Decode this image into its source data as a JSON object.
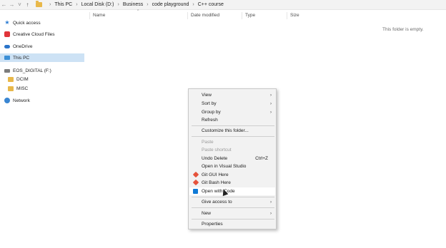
{
  "address_bar": {
    "back": "←",
    "forward": "→",
    "recent": "˅",
    "up": "↑",
    "breadcrumbs": [
      "This PC",
      "Local Disk (D:)",
      "Business",
      "code playground",
      "C++ course"
    ],
    "separator": "›"
  },
  "sidebar": {
    "items": [
      {
        "label": "Quick access",
        "icon": "star-icon"
      },
      {
        "label": "Creative Cloud Files",
        "icon": "creative-cloud-icon"
      },
      {
        "label": "OneDrive",
        "icon": "onedrive-icon"
      },
      {
        "label": "This PC",
        "icon": "this-pc-icon"
      },
      {
        "label": "EOS_DIGITAL (F:)",
        "icon": "drive-icon"
      },
      {
        "label": "DCIM",
        "icon": "folder-icon"
      },
      {
        "label": "MISC",
        "icon": "folder-icon"
      },
      {
        "label": "Network",
        "icon": "network-icon"
      }
    ]
  },
  "columns": {
    "name": "Name",
    "date_modified": "Date modified",
    "type": "Type",
    "size": "Size",
    "sort_caret": "^"
  },
  "empty_message": "This folder is empty.",
  "context_menu": {
    "items": [
      {
        "label": "View",
        "submenu": true
      },
      {
        "label": "Sort by",
        "submenu": true
      },
      {
        "label": "Group by",
        "submenu": true
      },
      {
        "label": "Refresh"
      },
      {
        "label": "Customize this folder..."
      },
      {
        "label": "Paste",
        "disabled": true
      },
      {
        "label": "Paste shortcut",
        "disabled": true
      },
      {
        "label": "Undo Delete",
        "shortcut": "Ctrl+Z"
      },
      {
        "label": "Open in Visual Studio"
      },
      {
        "label": "Git GUI Here",
        "icon": "git-icon"
      },
      {
        "label": "Git Bash Here",
        "icon": "git-icon"
      },
      {
        "label": "Open with Code",
        "icon": "vscode-icon",
        "highlighted": true
      },
      {
        "label": "Give access to",
        "submenu": true
      },
      {
        "label": "New",
        "submenu": true
      },
      {
        "label": "Properties"
      }
    ],
    "arrow": "›"
  },
  "colors": {
    "selected_sidebar": "#cde2f5",
    "menu_bg": "#f2f2f2",
    "folder": "#e8b84a",
    "accent": "#2b7cd3"
  }
}
